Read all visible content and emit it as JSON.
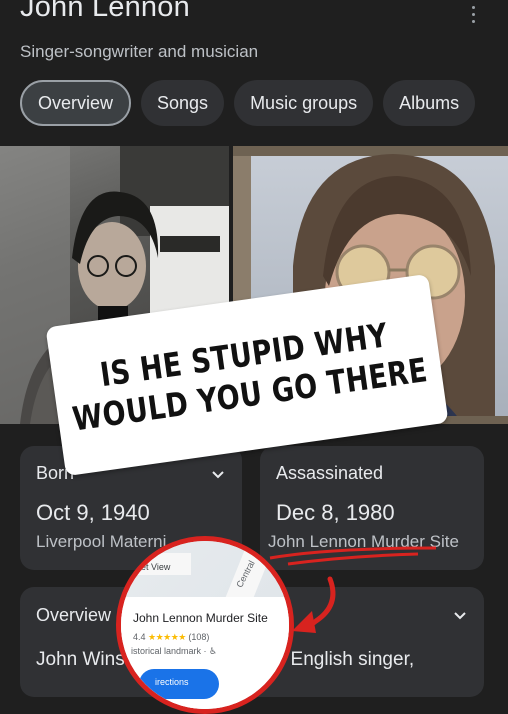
{
  "header": {
    "title": "John Lennon",
    "subtitle": "Singer-songwriter and musician"
  },
  "tabs": [
    {
      "label": "Overview",
      "active": true
    },
    {
      "label": "Songs",
      "active": false
    },
    {
      "label": "Music groups",
      "active": false
    },
    {
      "label": "Albums",
      "active": false
    }
  ],
  "overlay": {
    "line1": "IS HE STUPID WHY",
    "line2": "WOULD YOU GO THERE"
  },
  "born_card": {
    "label": "Born",
    "date": "Oct 9, 1940",
    "place": "Liverpool Materni"
  },
  "assassinated_card": {
    "label": "Assassinated",
    "date": "Dec 8, 1980",
    "place": "John Lennon Murder Site"
  },
  "overview_card": {
    "label": "Overview",
    "text": "John Winston Lennon was an English singer,"
  },
  "map_popup": {
    "street_view": "eet View",
    "road": "Central",
    "place_name": "John Lennon Murder Site",
    "rating": "4.4",
    "stars": "★★★★★",
    "reviews": "(108)",
    "category": "istorical landmark · ♿",
    "button": "irections"
  },
  "colors": {
    "background": "#1f1f1f",
    "card": "#303134",
    "annotation_red": "#d8231f"
  }
}
